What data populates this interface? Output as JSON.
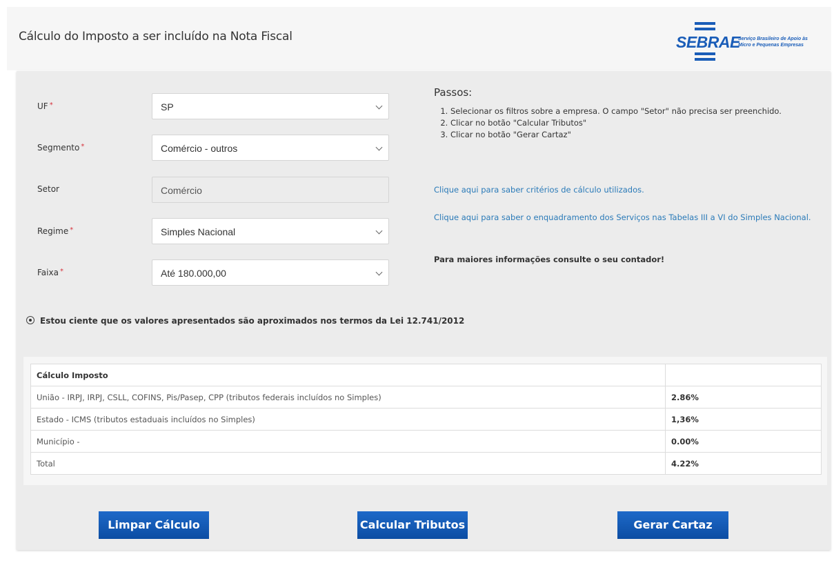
{
  "header": {
    "title": "Cálculo do Imposto a ser incluído na Nota Fiscal",
    "logo": {
      "word": "SEBRAE",
      "sub1": "Serviço Brasileiro de Apoio às",
      "sub2": "Micro e Pequenas Empresas"
    }
  },
  "form": {
    "uf": {
      "label": "UF",
      "required": "*",
      "value": "SP"
    },
    "segmento": {
      "label": "Segmento",
      "required": "*",
      "value": "Comércio - outros"
    },
    "setor": {
      "label": "Setor",
      "value": "Comércio"
    },
    "regime": {
      "label": "Regime",
      "required": "*",
      "value": "Simples Nacional"
    },
    "faixa": {
      "label": "Faixa",
      "required": "*",
      "value": "Até 180.000,00"
    }
  },
  "steps": {
    "title": "Passos:",
    "items": [
      "Selecionar os filtros sobre a empresa. O campo \"Setor\" não precisa ser preenchido.",
      "Clicar no botão \"Calcular Tributos\"",
      "Clicar no botão \"Gerar Cartaz\""
    ]
  },
  "links": {
    "criteria": "Clique aqui para saber critérios de cálculo utilizados.",
    "services": "Clique aqui para saber o enquadramento dos Serviços nas Tabelas III a VI do Simples Nacional."
  },
  "note": "Para maiores informações consulte o seu contador!",
  "acknowledge": "Estou ciente que os valores apresentados são aproximados nos termos da Lei 12.741/2012",
  "table": {
    "header": "Cálculo Imposto",
    "rows": [
      {
        "desc": "União - IRPJ, IRPJ, CSLL, COFINS, Pis/Pasep, CPP (tributos federais incluídos no Simples)",
        "value": "2.86%"
      },
      {
        "desc": "Estado - ICMS (tributos estaduais incluídos no Simples)",
        "value": "1,36%"
      },
      {
        "desc": "Município -",
        "value": "0.00%"
      },
      {
        "desc": "Total",
        "value": "4.22%"
      }
    ]
  },
  "buttons": {
    "clear": "Limpar Cálculo",
    "calculate": "Calcular Tributos",
    "poster": "Gerar Cartaz"
  },
  "colors": {
    "accent": "#1a5db8",
    "link": "#2a7ab8",
    "required": "#d6303a"
  }
}
